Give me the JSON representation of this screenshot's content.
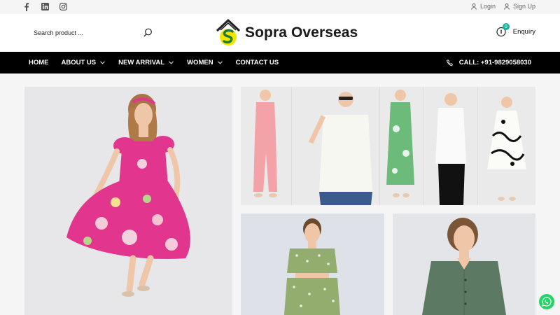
{
  "topbar": {
    "social": [
      "facebook-icon",
      "linkedin-icon",
      "instagram-icon"
    ],
    "login_label": "Login",
    "signup_label": "Sign Up"
  },
  "header": {
    "search_placeholder": "Search product ...",
    "brand": "Sopra Overseas",
    "enquiry_label": "Enquiry",
    "enquiry_count": "0"
  },
  "nav": {
    "items": [
      {
        "label": "HOME",
        "dropdown": false
      },
      {
        "label": "ABOUT US",
        "dropdown": true
      },
      {
        "label": "NEW ARRIVAL",
        "dropdown": true
      },
      {
        "label": "WOMEN",
        "dropdown": true
      },
      {
        "label": "CONTACT US",
        "dropdown": false
      }
    ],
    "call_label": "CALL: +91-9829058030"
  },
  "colors": {
    "nav_bg": "#000000",
    "accent_teal": "#18b39a",
    "logo_yellow": "#f2e600",
    "logo_green": "#1e7a3a",
    "whatsapp": "#25d366",
    "hero_dress_pink": "#e2358d"
  },
  "images": {
    "hero": "model in pink floral dress",
    "collage": "five models in pink set, white eyelet shirt, green print dress, white knot shirt, black and white print dress",
    "tile3": "model in green polka dot set",
    "tile4": "model in green button shirt"
  }
}
